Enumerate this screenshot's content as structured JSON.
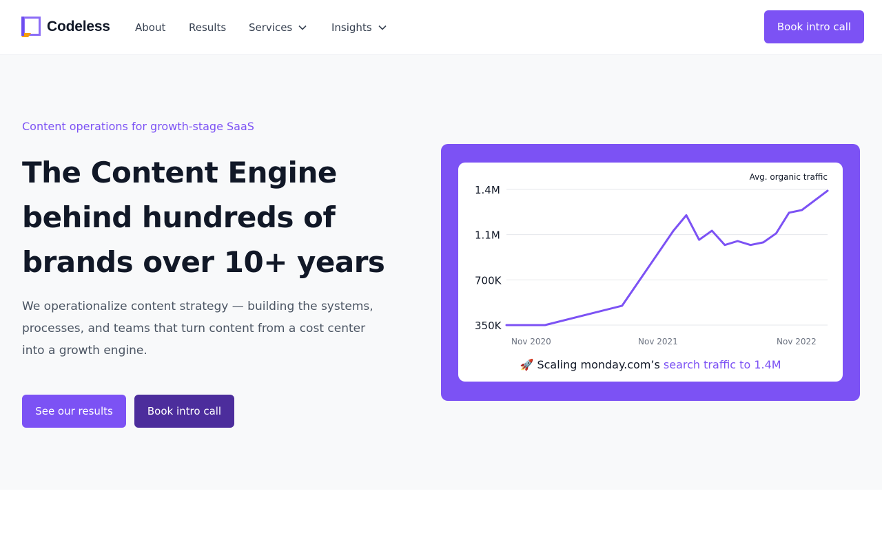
{
  "header": {
    "brand": "Codeless",
    "nav": [
      {
        "label": "About"
      },
      {
        "label": "Results"
      },
      {
        "label": "Services"
      },
      {
        "label": "Insights"
      }
    ],
    "cta_label": "Book intro call"
  },
  "hero": {
    "eyebrow": "Content operations for growth-stage SaaS",
    "headline": "The Content Engine behind hundreds of brands over 10+ years",
    "subtext": "We operationalize content strategy — building the systems, processes, and teams that turn content from a cost center into a growth engine.",
    "primary_button": "See our results",
    "secondary_button": "Book intro call"
  },
  "caption": {
    "emoji": "🚀",
    "text": "Scaling monday.com’s",
    "highlight": "search traffic to 1.4M"
  },
  "colors": {
    "accent": "#7c52f4",
    "accent_dark": "#4c2d9c",
    "text": "#111827"
  },
  "chart_data": {
    "type": "line",
    "title": "Avg. organic traffic",
    "x_ticks": [
      "Nov 2020",
      "Nov 2021",
      "Nov 2022"
    ],
    "y_ticks": [
      "1.4M",
      "1.1M",
      "700K",
      "350K"
    ],
    "y_tick_values": [
      1400000,
      1050000,
      700000,
      350000
    ],
    "ylim": [
      350000,
      1400000
    ],
    "grid": true,
    "series": [
      {
        "x": [
          "Sep 2020",
          "Dec 2020",
          "Jun 2021",
          "Oct 2021",
          "Nov 2021",
          "Dec 2021",
          "Jan 2022",
          "Feb 2022",
          "Mar 2022",
          "Apr 2022",
          "May 2022",
          "Jun 2022",
          "Jul 2022",
          "Aug 2022",
          "Oct 2022"
        ],
        "y": [
          350000,
          350000,
          500000,
          1080000,
          1200000,
          1010000,
          1080000,
          970000,
          1000000,
          970000,
          990000,
          1060000,
          1220000,
          1240000,
          1390000
        ],
        "color": "#7c52f4"
      }
    ]
  }
}
